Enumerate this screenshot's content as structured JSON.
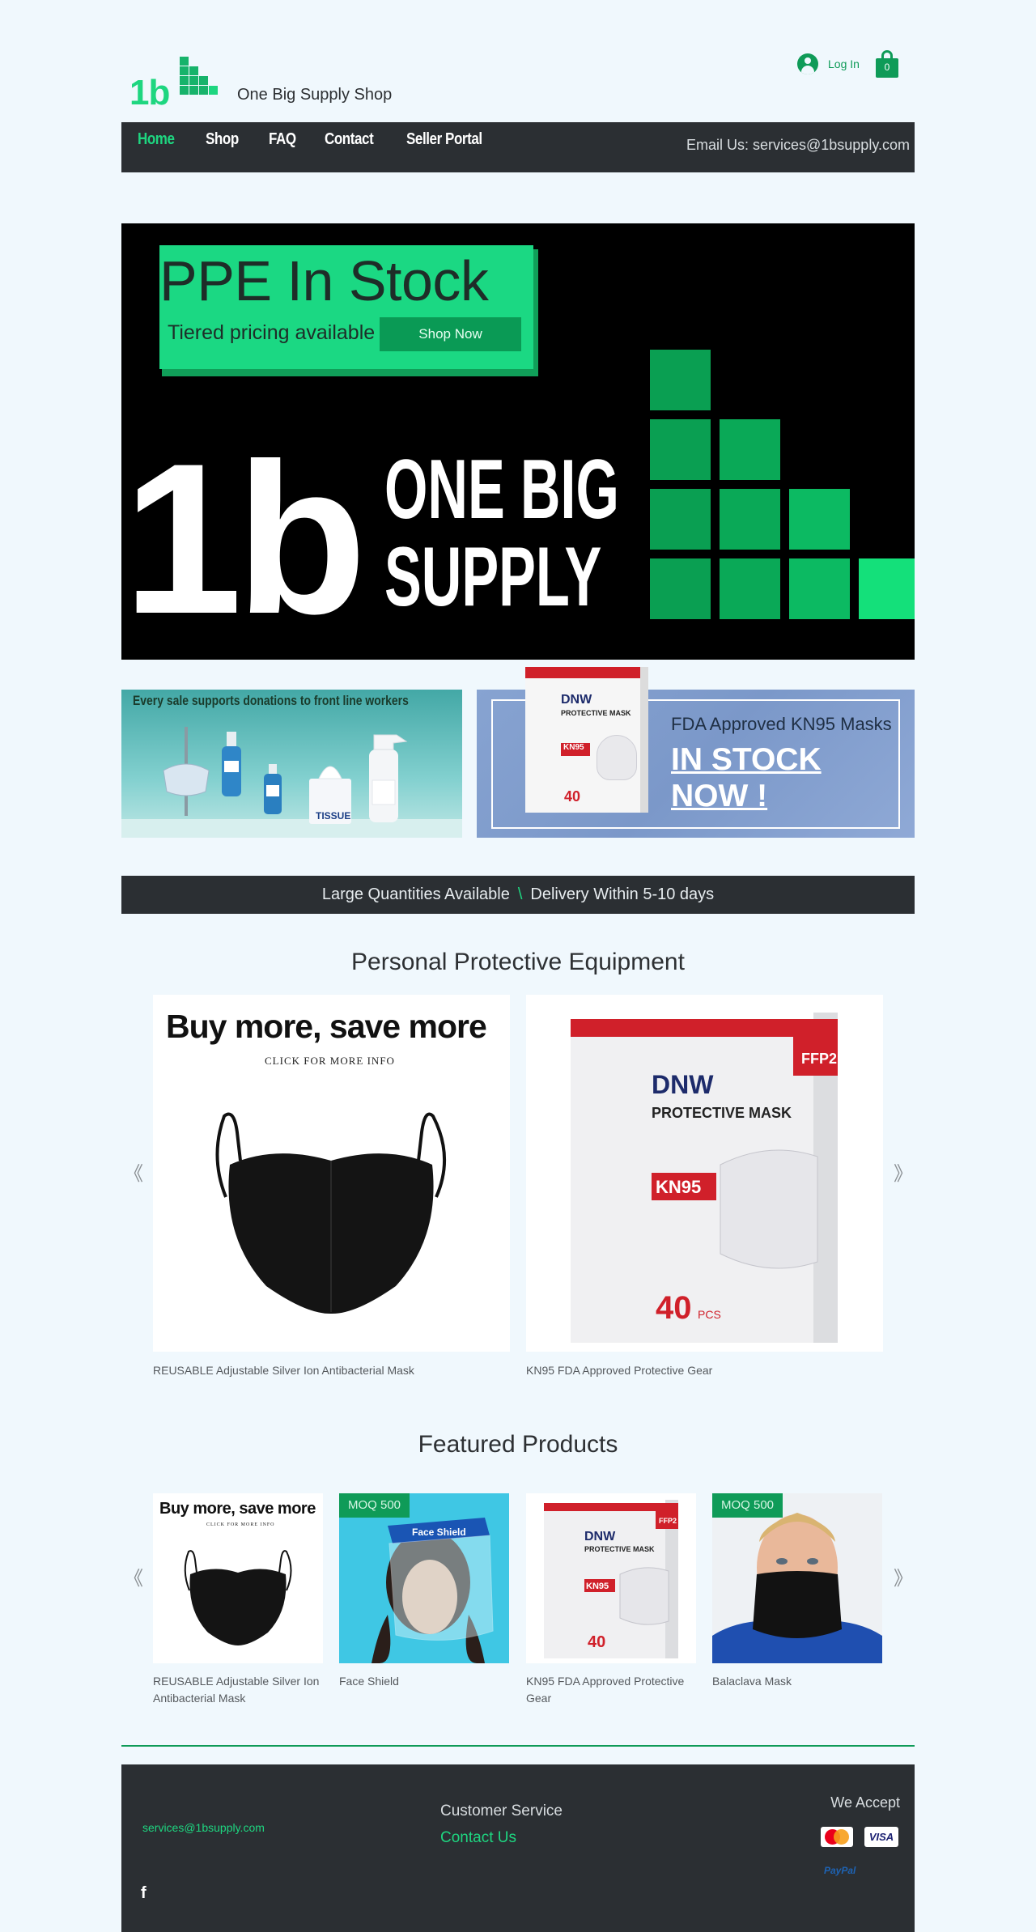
{
  "header": {
    "logo_text": "1b",
    "shop_name": "One Big Supply Shop",
    "login_label": "Log In",
    "cart_count": "0"
  },
  "nav": {
    "items": [
      {
        "label": "Home",
        "active": true
      },
      {
        "label": "Shop"
      },
      {
        "label": "FAQ"
      },
      {
        "label": "Contact"
      },
      {
        "label": "Seller Portal"
      }
    ],
    "email": "Email Us: services@1bsupply.com"
  },
  "hero": {
    "title": "PPE In Stock",
    "subtitle": "Tiered pricing available",
    "button": "Shop Now",
    "big_logo": "1b",
    "brand_line1": "ONE BIG",
    "brand_line2": "SUPPLY"
  },
  "promos": {
    "left_caption": "Every sale supports donations to front line workers",
    "right_title": "FDA Approved KN95 Masks",
    "right_line1": "IN STOCK",
    "right_line2": "NOW !",
    "box_brand": "DNW",
    "box_product": "PROTECTIVE MASK",
    "box_tag": "KN95",
    "box_count": "40",
    "box_badge": "FFP2"
  },
  "strip": {
    "left": "Large Quantities Available",
    "sep": "\\",
    "right": "Delivery Within 5-10 days"
  },
  "ppe_section": {
    "title": "Personal Protective Equipment",
    "buy_more": "Buy more, save more",
    "click_info": "CLICK FOR MORE INFO",
    "products": [
      {
        "name": "REUSABLE Adjustable Silver Ion Antibacterial Mask"
      },
      {
        "name": "KN95 FDA Approved Protective Gear"
      }
    ],
    "prev": "《",
    "next": "》"
  },
  "featured": {
    "title": "Featured Products",
    "products": [
      {
        "name": "REUSABLE Adjustable Silver Ion Antibacterial Mask",
        "badge": ""
      },
      {
        "name": "Face Shield",
        "badge": "MOQ 500",
        "shield_text": "Face Shield"
      },
      {
        "name": "KN95 FDA Approved Protective Gear",
        "badge": ""
      },
      {
        "name": "Balaclava Mask",
        "badge": "MOQ 500"
      }
    ],
    "prev": "《",
    "next": "》"
  },
  "footer": {
    "email": "services@1bsupply.com",
    "facebook": "f",
    "customer_service": "Customer Service",
    "contact_us": "Contact Us",
    "we_accept": "We Accept",
    "visa": "VISA",
    "paypal": "PayPal"
  },
  "colors": {
    "accent_green": "#1ed680",
    "dark_green": "#0f9b58",
    "nav_bg": "#2b2f33",
    "page_bg": "#f0f8fd"
  }
}
